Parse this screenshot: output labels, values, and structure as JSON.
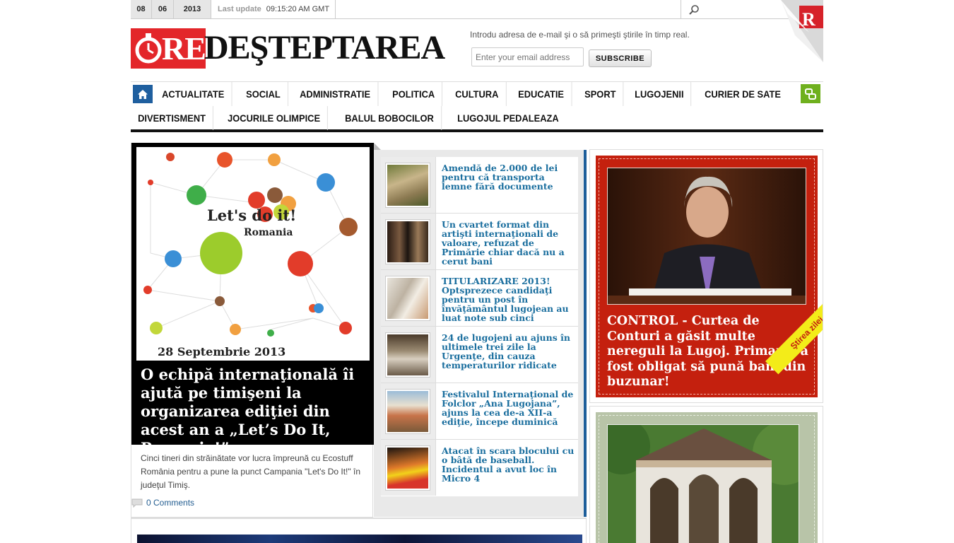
{
  "topbar": {
    "day": "08",
    "month": "06",
    "year": "2013",
    "update_label": "Last update",
    "update_time": "09:15:20 AM GMT"
  },
  "logo": {
    "re": "RE",
    "word": "DEŞTEPTAREA"
  },
  "newsletter": {
    "text": "Introdu adresa de e-mail şi o să primeşti ştirile în timp real.",
    "placeholder": "Enter your email address",
    "button": "SUBSCRIBE"
  },
  "nav": {
    "row1": [
      "ACTUALITATE",
      "SOCIAL",
      "ADMINISTRATIE",
      "POLITICA",
      "CULTURA",
      "EDUCATIE",
      "SPORT",
      "LUGOJENII",
      "CURIER DE SATE"
    ],
    "row2": [
      "DIVERTISMENT",
      "JOCURILE OLIMPICE",
      "BALUL BOBOCILOR",
      "LUGOJUL PEDALEAZA"
    ]
  },
  "feature": {
    "image_caption_title": "Let's do it!",
    "image_caption_sub": "Romania",
    "image_date": "28 Septembrie 2013",
    "title": "O echipă internaţională îi ajută pe timişeni la organizarea ediţiei din acest an a „Let’s Do It, Romania!”",
    "excerpt": "Cinci tineri din străinătate vor lucra împreună cu Ecostuff România pentru a pune la punct Campania \"Let's Do It!\" în judeţul Timiş.",
    "comments": "0 Comments"
  },
  "headlines": [
    {
      "title": "Amendă de 2.000 de lei pentru că transporta lemne fără documente"
    },
    {
      "title": "Un cvartet format din artişti internaţionali de valoare, refuzat de Primărie chiar dacă nu a cerut bani"
    },
    {
      "title": "TITULARIZARE 2013! Optsprezece candidaţi pentru un post în învăţământul lugojean au luat note sub cinci"
    },
    {
      "title": "24 de lugojeni au ajuns în ultimele trei zile la Urgenţe, din cauza temperaturilor ridicate"
    },
    {
      "title": "Festivalul Internaţional de Folclor „Ana Lugojana”, ajuns la cea de-a XII-a ediţie, începe duminică"
    },
    {
      "title": "Atacat în scara blocului cu o bâtă de baseball. Incidentul a avut loc în Micro 4"
    }
  ],
  "side": {
    "title": "CONTROL - Curtea de Conturi a găsit multe nereguli la Lugoj. Primarul a fost obligat să pună bani din buzunar!",
    "ribbon": "Ştirea zilei"
  },
  "colors": {
    "brand_red": "#e3262a",
    "link_blue": "#1a6e9e",
    "nav_blue": "#1f5f9f",
    "accent_green": "#6fb01e",
    "feature_red": "#c4200e"
  }
}
